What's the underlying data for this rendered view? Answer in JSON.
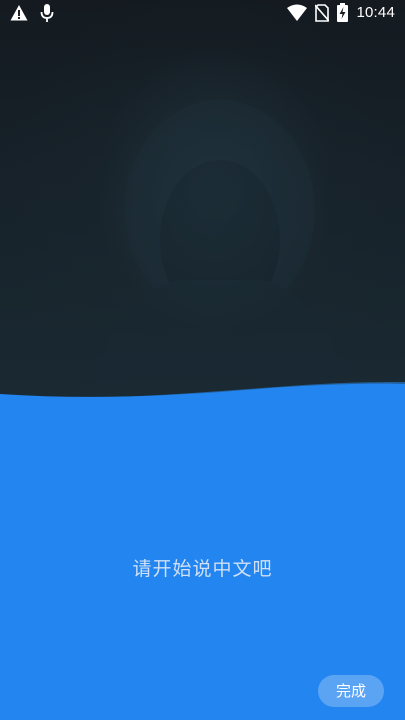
{
  "status_bar": {
    "time": "10:44",
    "icons": [
      "warning-icon",
      "microphone-icon",
      "wifi-icon",
      "no-sim-icon",
      "battery-charging-icon"
    ]
  },
  "colors": {
    "top_background": "#16222a",
    "sheet_blue": "#2285f0",
    "prompt_text": "#cfe0f7"
  },
  "voice_input": {
    "prompt": "请开始说中文吧",
    "done_label": "完成"
  }
}
